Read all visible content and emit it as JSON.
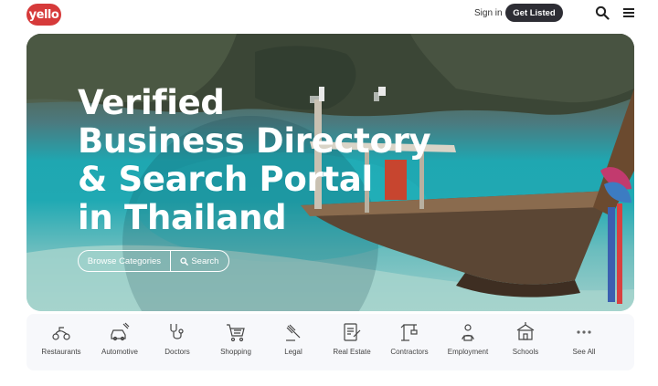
{
  "header": {
    "logo_text": "yello",
    "sign_in": "Sign in",
    "get_listed": "Get Listed",
    "icons": [
      "search-icon",
      "menu-icon"
    ]
  },
  "hero": {
    "title_lines": [
      "Verified",
      "Business Directory",
      "& Search Portal",
      "in Thailand"
    ],
    "browse_label": "Browse Categories",
    "search_label": "Search"
  },
  "categories": [
    {
      "label": "Restaurants",
      "icon": "scooter-icon"
    },
    {
      "label": "Automotive",
      "icon": "car-repair-icon"
    },
    {
      "label": "Doctors",
      "icon": "stethoscope-icon"
    },
    {
      "label": "Shopping",
      "icon": "cart-icon"
    },
    {
      "label": "Legal",
      "icon": "gavel-icon"
    },
    {
      "label": "Real Estate",
      "icon": "contract-icon"
    },
    {
      "label": "Contractors",
      "icon": "crane-icon"
    },
    {
      "label": "Employment",
      "icon": "worker-icon"
    },
    {
      "label": "Schools",
      "icon": "school-icon"
    },
    {
      "label": "See All",
      "icon": "more-dots-icon"
    }
  ],
  "colors": {
    "brand": "#d63a3a",
    "button_dark": "#2d2d34",
    "water": "#1fa7b1"
  }
}
